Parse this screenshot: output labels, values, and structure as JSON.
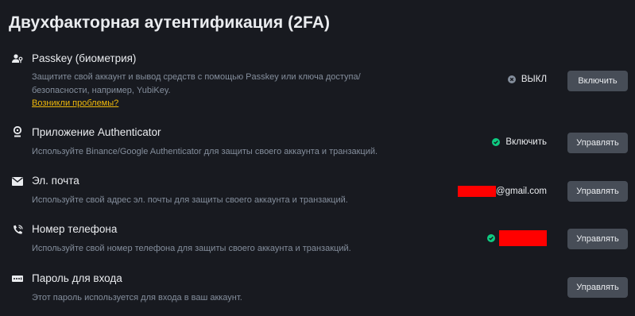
{
  "title": "Двухфакторная аутентификация (2FA)",
  "colors": {
    "background": "#181a20",
    "button": "#474d57",
    "link": "#f0b90b",
    "success": "#0ecb81",
    "muted": "#848e9c",
    "redaction": "#ff0000"
  },
  "passkey": {
    "name": "Passkey (биометрия)",
    "desc1": "Защитите свой аккаунт и вывод средств с помощью Passkey или ключа доступа/",
    "desc2": "безопасности, например, YubiKey.",
    "link": "Возникли проблемы?",
    "status": "ВЫКЛ",
    "status_icon": "x-circle-icon",
    "button": "Включить",
    "icon": "user-key-icon"
  },
  "authenticator": {
    "name": "Приложение Authenticator",
    "desc": "Используйте Binance/Google Authenticator для защиты своего аккаунта и транзакций.",
    "status": "Включить",
    "status_icon": "check-circle-icon",
    "button": "Управлять",
    "icon": "authenticator-icon"
  },
  "email": {
    "name": "Эл. почта",
    "desc": "Используйте свой адрес эл. почты для защиты своего аккаунта и транзакций.",
    "status": "@gmail.com",
    "button": "Управлять",
    "icon": "mail-icon"
  },
  "phone": {
    "name": "Номер телефона",
    "desc": "Используйте свой номер телефона для защиты своего аккаунта и транзакций.",
    "status_icon": "check-circle-icon",
    "button": "Управлять",
    "icon": "phone-icon"
  },
  "password": {
    "name": "Пароль для входа",
    "desc": "Этот пароль используется для входа в ваш аккаунт.",
    "button": "Управлять",
    "icon": "password-icon"
  }
}
